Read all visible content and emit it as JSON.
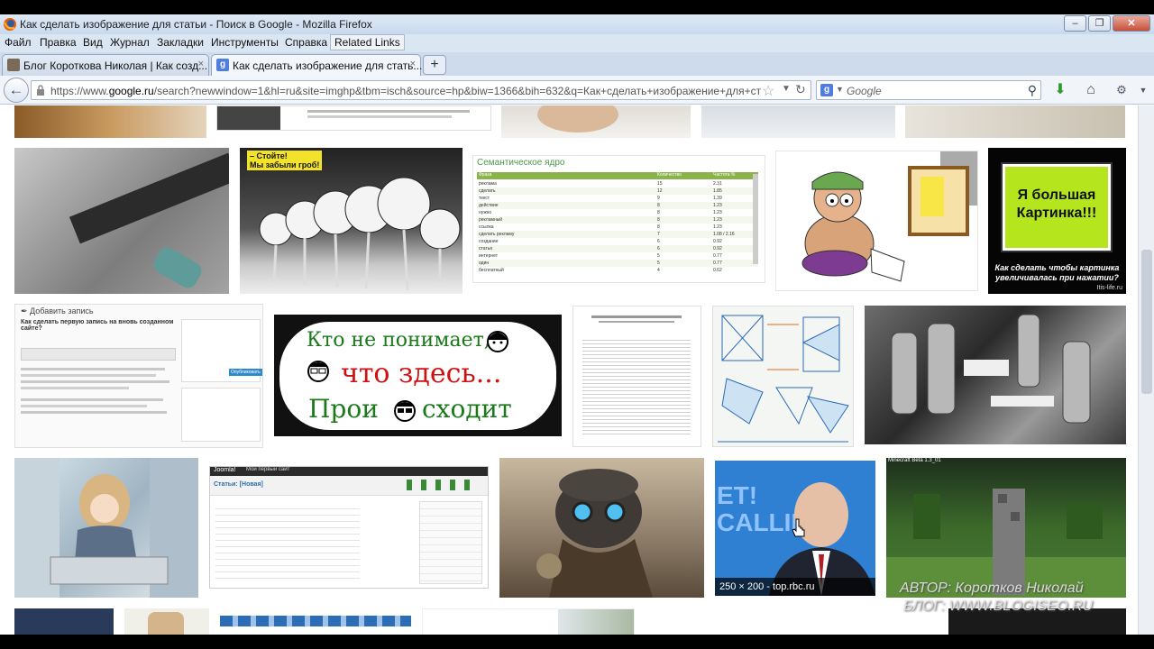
{
  "window": {
    "title": "Как сделать изображение для статьи - Поиск в Google - Mozilla Firefox",
    "controls": [
      "–",
      "❐",
      "✕"
    ]
  },
  "menu": [
    "Файл",
    "Правка",
    "Вид",
    "Журнал",
    "Закладки",
    "Инструменты",
    "Справка",
    "Related Links"
  ],
  "tabs": [
    {
      "label": "Блог Короткова Николая | Как созд...",
      "active": false
    },
    {
      "label": "Как сделать изображение для стать...",
      "active": true
    }
  ],
  "tab_close": "×",
  "new_tab": "+",
  "nav": {
    "url_prefix": "https://www.",
    "url_domain": "google.ru",
    "url_rest": "/search?newwindow=1&hl=ru&site=imghp&tbm=isch&source=hp&biw=1366&bih=632&q=Как+сделать+изображение+для+статьи",
    "search_placeholder": "Google",
    "search_engine_icon": "google-icon"
  },
  "images": {
    "chart_title": "Семантическое ядро",
    "chart_headers": [
      "Фраза",
      "Количество",
      "Частота %"
    ],
    "chart_rows": [
      [
        "реклама",
        "15",
        "2.31"
      ],
      [
        "сделать",
        "12",
        "1.85"
      ],
      [
        "текст",
        "9",
        "1.39"
      ],
      [
        "действие",
        "8",
        "1.23"
      ],
      [
        "нужно",
        "8",
        "1.23"
      ],
      [
        "рекламный",
        "8",
        "1.23"
      ],
      [
        "ссылка",
        "8",
        "1.23"
      ],
      [
        "сделать рекламу",
        "7",
        "1.08 / 2.16"
      ],
      [
        "создание",
        "6",
        "0.92"
      ],
      [
        "статья",
        "6",
        "0.92"
      ],
      [
        "интернет",
        "5",
        "0.77"
      ],
      [
        "один",
        "5",
        "0.77"
      ],
      [
        "бесплатный",
        "4",
        "0.62"
      ]
    ],
    "alarm_banner": [
      "– Стойте!",
      "Мы забыли гроб!"
    ],
    "big_picture_text": "Я большая Картинка!!!",
    "big_picture_caption": "Как сделать чтобы картинка увеличивалась при нажатии?",
    "big_picture_site": "Itis-life.ru",
    "wp_header": "Добавить запись",
    "wp_title": "Как сделать первую запись на вновь созданном сайте?",
    "wp_button": "Опубликовать",
    "sign_line1": "Кто не понимает,",
    "sign_line2": "что здесь...",
    "sign_line3a": "Прои",
    "sign_line3b": "сходит",
    "joomla_brand": "Joomla!",
    "joomla_site": "Мой первый сайт",
    "joomla_title": "Статьи: [Новая]",
    "putin_caption": "250 × 200 - top.rbc.ru",
    "minecraft_caption": "Minecraft Beta 1.3_01",
    "poster_text": "ET! CALLIN"
  },
  "watermark": {
    "author": "АВТОР: Коротков Николай",
    "blog": "БЛОГ: WWW.BLOGISEO.RU"
  },
  "colors": {
    "chrome_bg": "#dbe6f3",
    "accent_green": "#b5e61d",
    "sign_red": "#d01010",
    "sign_green": "#1a7a1a"
  }
}
